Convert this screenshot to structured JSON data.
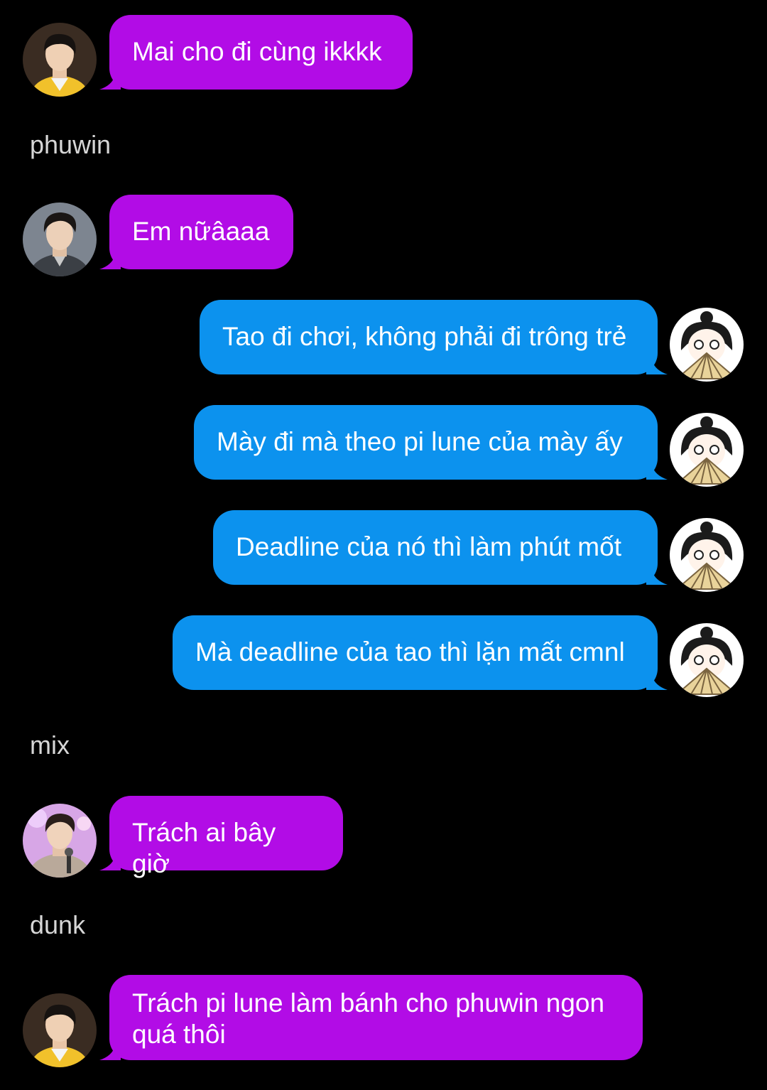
{
  "colors": {
    "background": "#000000",
    "incoming_bubble": "#b20ce6",
    "outgoing_bubble": "#0c92ee",
    "sender_label": "#d6d6d6",
    "text": "#ffffff"
  },
  "messages": [
    {
      "sender_label": "",
      "avatar": "avatar-yellow-jacket",
      "text": "Mai cho đi cùng ikkkk"
    },
    {
      "sender_label": "phuwin",
      "avatar": "avatar-dark-jacket",
      "text": "Em nữâaaa"
    },
    {
      "sender_label": "",
      "avatar": "avatar-anime-fan",
      "text": "Tao đi chơi, không phải đi trông trẻ"
    },
    {
      "sender_label": "",
      "avatar": "avatar-anime-fan",
      "text": "Mày đi mà theo pi lune của mày ấy"
    },
    {
      "sender_label": "",
      "avatar": "avatar-anime-fan",
      "text": "Deadline của nó thì làm phút mốt"
    },
    {
      "sender_label": "",
      "avatar": "avatar-anime-fan",
      "text": "Mà deadline của tao thì lặn mất cmnl"
    },
    {
      "sender_label": "mix",
      "avatar": "avatar-stage-microphone",
      "text": "Trách ai bây giờ"
    },
    {
      "sender_label": "dunk",
      "avatar": "avatar-yellow-jacket",
      "text": "Trách pi lune làm bánh cho phuwin ngon\nquá thôi"
    }
  ]
}
